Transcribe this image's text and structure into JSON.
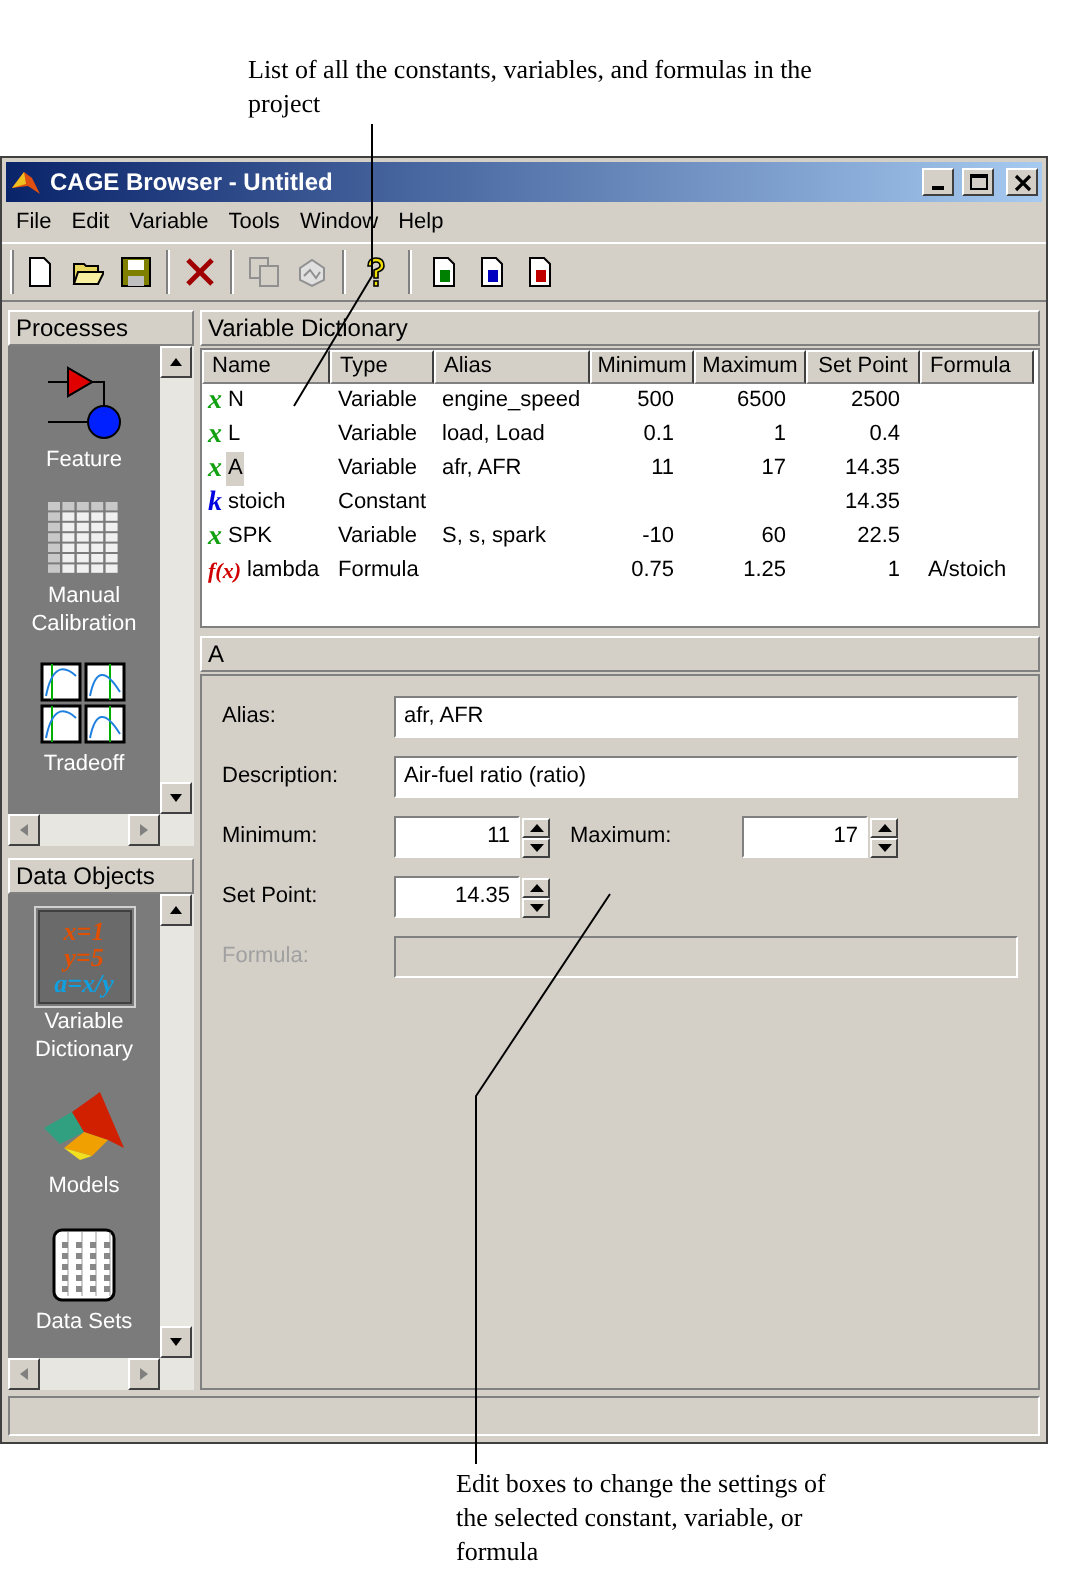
{
  "annotations": {
    "top": "List of all the constants, variables, and formulas in the project",
    "bottom": "Edit boxes to change the settings of the selected constant, variable, or formula"
  },
  "window": {
    "title": "CAGE Browser - Untitled"
  },
  "menu": [
    "File",
    "Edit",
    "Variable",
    "Tools",
    "Window",
    "Help"
  ],
  "processes": {
    "title": "Processes",
    "items": [
      {
        "kind": "feature",
        "label": "Feature",
        "selected": false
      },
      {
        "kind": "calibration",
        "label": "Manual Calibration",
        "selected": false
      },
      {
        "kind": "tradeoff",
        "label": "Tradeoff",
        "selected": false
      }
    ]
  },
  "data_objects": {
    "title": "Data Objects",
    "items": [
      {
        "kind": "dictionary",
        "label": "Variable Dictionary",
        "selected": true,
        "icon_lines": [
          "x=1",
          "y=5",
          "a=x/y"
        ]
      },
      {
        "kind": "models",
        "label": "Models",
        "selected": false
      },
      {
        "kind": "datasets",
        "label": "Data Sets",
        "selected": false
      }
    ]
  },
  "dictionary": {
    "title": "Variable Dictionary",
    "columns": [
      "Name",
      "Type",
      "Alias",
      "Minimum",
      "Maximum",
      "Set Point",
      "Formula"
    ],
    "rows": [
      {
        "kind": "variable",
        "symbol": "x",
        "name": "N",
        "type": "Variable",
        "alias": "engine_speed",
        "minimum": "500",
        "maximum": "6500",
        "set_point": "2500",
        "selected": false
      },
      {
        "kind": "variable",
        "symbol": "x",
        "name": "L",
        "type": "Variable",
        "alias": "load, Load",
        "minimum": "0.1",
        "maximum": "1",
        "set_point": "0.4",
        "selected": false
      },
      {
        "kind": "variable",
        "symbol": "x",
        "name": "A",
        "type": "Variable",
        "alias": "afr, AFR",
        "minimum": "11",
        "maximum": "17",
        "set_point": "14.35",
        "selected": true
      },
      {
        "kind": "constant",
        "symbol": "k",
        "name": "stoich",
        "type": "Constant",
        "set_point": "14.35",
        "selected": false
      },
      {
        "kind": "variable",
        "symbol": "x",
        "name": "SPK",
        "type": "Variable",
        "alias": "S, s, spark",
        "minimum": "-10",
        "maximum": "60",
        "set_point": "22.5",
        "selected": false
      },
      {
        "kind": "formula",
        "symbol": "f(x)",
        "name": "lambda",
        "type": "Formula",
        "minimum": "0.75",
        "maximum": "1.25",
        "set_point": "1",
        "formula": "A/stoich",
        "selected": false
      }
    ]
  },
  "details": {
    "title": "A",
    "alias": {
      "label": "Alias:",
      "value": "afr, AFR"
    },
    "description": {
      "label": "Description:",
      "value": "Air-fuel ratio (ratio)"
    },
    "minimum": {
      "label": "Minimum:",
      "value": "11"
    },
    "maximum": {
      "label": "Maximum:",
      "value": "17"
    },
    "set_point": {
      "label": "Set Point:",
      "value": "14.35"
    },
    "formula": {
      "label": "Formula:",
      "disabled": true
    }
  }
}
